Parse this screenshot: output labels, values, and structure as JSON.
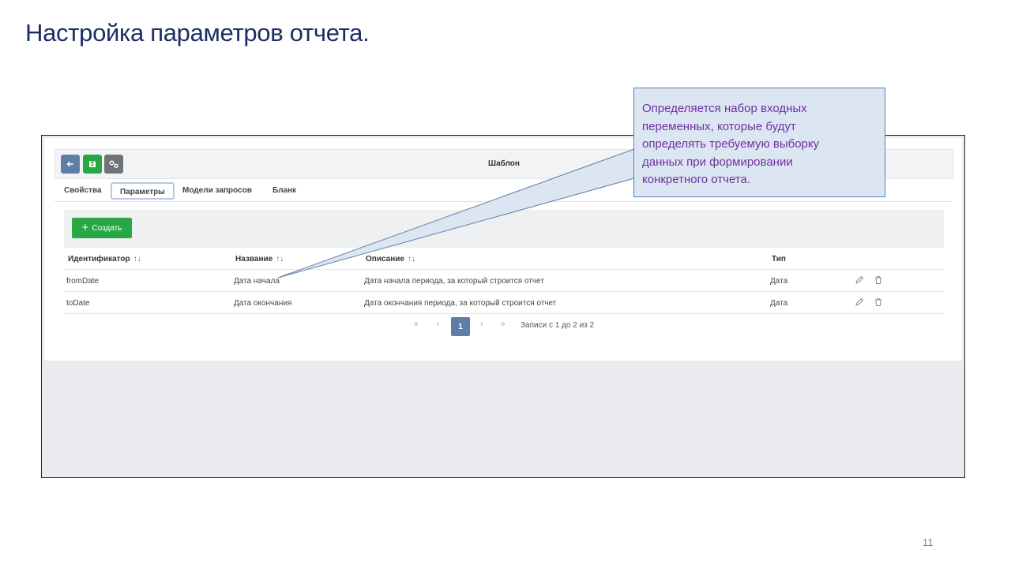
{
  "slide": {
    "title": "Настройка параметров отчета.",
    "page_number": "11"
  },
  "callout": {
    "lines": [
      "Определяется набор входных",
      "переменных, которые будут",
      "определять требуемую выборку",
      "данных при формировании",
      "конкретного отчета."
    ]
  },
  "toolbar": {
    "title": "Шаблон",
    "back_icon": "arrow-left-icon",
    "save_icon": "save-icon",
    "settings_icon": "gears-icon"
  },
  "tabs": [
    {
      "label": "Свойства",
      "active": false
    },
    {
      "label": "Параметры",
      "active": true
    },
    {
      "label": "Модели запросов",
      "active": false
    },
    {
      "label": "Бланк",
      "active": false
    }
  ],
  "create_button": {
    "label": "Создать",
    "icon": "plus-icon"
  },
  "table": {
    "columns": [
      {
        "label": "Идентификатор",
        "sortable": true
      },
      {
        "label": "Название",
        "sortable": true
      },
      {
        "label": "Описание",
        "sortable": true
      },
      {
        "label": "Тип",
        "sortable": false
      }
    ],
    "rows": [
      {
        "id": "fromDate",
        "name": "Дата начала",
        "description": "Дата начала периода, за который строится отчет",
        "type": "Дата"
      },
      {
        "id": "toDate",
        "name": "Дата окончания",
        "description": "Дата окончания периода, за который строится отчет",
        "type": "Дата"
      }
    ]
  },
  "pagination": {
    "first": "«",
    "prev": "‹",
    "current": "1",
    "next": "›",
    "last": "»",
    "info": "Записи с 1 до 2 из 2"
  },
  "colors": {
    "title": "#1b2e63",
    "primary": "#5c7ea8",
    "success": "#28a745",
    "callout_bg": "#dce6f2",
    "callout_text": "#7030a0"
  }
}
